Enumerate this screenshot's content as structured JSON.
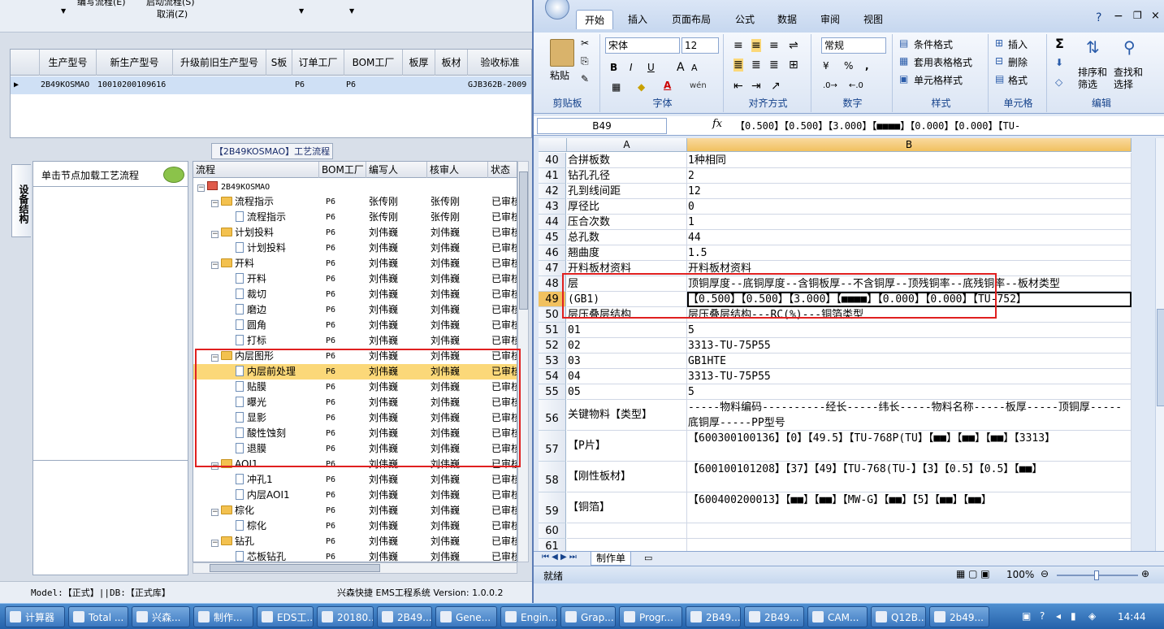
{
  "left_app": {
    "top_menu": {
      "item1": "编写流程(E)",
      "item2": "启动流程(S)",
      "cancel": "取消(Z)"
    },
    "product_grid": {
      "columns": [
        "生产型号",
        "新生产型号",
        "升级前旧生产型号",
        "S板",
        "订单工厂",
        "BOM工厂",
        "板厚",
        "板材",
        "验收标准"
      ],
      "row": {
        "marker": "▶",
        "prod_model": "2B49KOSMAO",
        "new_model": "10010200109616",
        "s_board": "",
        "order_factory": "P6",
        "bom_factory": "P6",
        "standard": "GJB362B-2009"
      }
    },
    "process_title": "【2B49KOSMAO】工艺流程",
    "side_tab": "设备结构",
    "load_hint": "单击节点加载工艺流程",
    "tree_columns": [
      "流程",
      "BOM工厂",
      "编写人",
      "核审人",
      "状态"
    ],
    "tree_root": "2B49KOSMAO",
    "tree_rows": [
      {
        "label": "流程指示",
        "factory": "P6",
        "author": "张传刚",
        "reviewer": "张传刚",
        "status": "已审核"
      },
      {
        "label": "流程指示",
        "factory": "P6",
        "author": "张传刚",
        "reviewer": "张传刚",
        "status": "已审核"
      },
      {
        "label": "计划投料",
        "factory": "P6",
        "author": "刘伟巍",
        "reviewer": "刘伟巍",
        "status": "已审核"
      },
      {
        "label": "计划投料",
        "factory": "P6",
        "author": "刘伟巍",
        "reviewer": "刘伟巍",
        "status": "已审核"
      },
      {
        "label": "开料",
        "factory": "P6",
        "author": "刘伟巍",
        "reviewer": "刘伟巍",
        "status": "已审核"
      },
      {
        "label": "开料",
        "factory": "P6",
        "author": "刘伟巍",
        "reviewer": "刘伟巍",
        "status": "已审核"
      },
      {
        "label": "裁切",
        "factory": "P6",
        "author": "刘伟巍",
        "reviewer": "刘伟巍",
        "status": "已审核"
      },
      {
        "label": "磨边",
        "factory": "P6",
        "author": "刘伟巍",
        "reviewer": "刘伟巍",
        "status": "已审核"
      },
      {
        "label": "圆角",
        "factory": "P6",
        "author": "刘伟巍",
        "reviewer": "刘伟巍",
        "status": "已审核"
      },
      {
        "label": "打标",
        "factory": "P6",
        "author": "刘伟巍",
        "reviewer": "刘伟巍",
        "status": "已审核"
      },
      {
        "label": "内层图形",
        "factory": "P6",
        "author": "刘伟巍",
        "reviewer": "刘伟巍",
        "status": "已审核"
      },
      {
        "label": "内层前处理",
        "factory": "P6",
        "author": "刘伟巍",
        "reviewer": "刘伟巍",
        "status": "已审核"
      },
      {
        "label": "贴膜",
        "factory": "P6",
        "author": "刘伟巍",
        "reviewer": "刘伟巍",
        "status": "已审核"
      },
      {
        "label": "曝光",
        "factory": "P6",
        "author": "刘伟巍",
        "reviewer": "刘伟巍",
        "status": "已审核"
      },
      {
        "label": "显影",
        "factory": "P6",
        "author": "刘伟巍",
        "reviewer": "刘伟巍",
        "status": "已审核"
      },
      {
        "label": "酸性蚀刻",
        "factory": "P6",
        "author": "刘伟巍",
        "reviewer": "刘伟巍",
        "status": "已审核"
      },
      {
        "label": "退膜",
        "factory": "P6",
        "author": "刘伟巍",
        "reviewer": "刘伟巍",
        "status": "已审核"
      },
      {
        "label": "AOI1",
        "factory": "P6",
        "author": "刘伟巍",
        "reviewer": "刘伟巍",
        "status": "已审核"
      },
      {
        "label": "冲孔1",
        "factory": "P6",
        "author": "刘伟巍",
        "reviewer": "刘伟巍",
        "status": "已审核"
      },
      {
        "label": "内层AOI1",
        "factory": "P6",
        "author": "刘伟巍",
        "reviewer": "刘伟巍",
        "status": "已审核"
      },
      {
        "label": "棕化",
        "factory": "P6",
        "author": "刘伟巍",
        "reviewer": "刘伟巍",
        "status": "已审核"
      },
      {
        "label": "棕化",
        "factory": "P6",
        "author": "刘伟巍",
        "reviewer": "刘伟巍",
        "status": "已审核"
      },
      {
        "label": "钻孔",
        "factory": "P6",
        "author": "刘伟巍",
        "reviewer": "刘伟巍",
        "status": "已审核"
      },
      {
        "label": "芯板钻孔",
        "factory": "P6",
        "author": "刘伟巍",
        "reviewer": "刘伟巍",
        "status": "已审核"
      }
    ],
    "status_bar": {
      "model": "Model:【正式】||DB:【正式库】",
      "app": "兴森快捷 EMS工程系统 Version: 1.0.0.2"
    }
  },
  "excel": {
    "ribbon_tabs": [
      "开始",
      "插入",
      "页面布局",
      "公式",
      "数据",
      "审阅",
      "视图"
    ],
    "clipboard": {
      "paste": "粘贴",
      "label": "剪贴板"
    },
    "font": {
      "name": "宋体",
      "size": "12",
      "bold": "B",
      "italic": "I",
      "underline": "U",
      "grow": "A",
      "shrink": "A",
      "label": "字体",
      "color_a": "A",
      "wen": "wén"
    },
    "alignment": {
      "label": "对齐方式"
    },
    "number": {
      "format": "常规",
      "percent": "%",
      "comma": ",",
      "label": "数字"
    },
    "styles": {
      "conditional": "条件格式",
      "table": "套用表格格式",
      "cell": "单元格样式",
      "label": "样式"
    },
    "cells": {
      "insert": "插入",
      "delete": "删除",
      "format": "格式",
      "label": "单元格"
    },
    "editing": {
      "sum": "Σ",
      "sort": "排序和\n筛选",
      "find": "查找和\n选择",
      "label": "编辑"
    },
    "name_box": "B49",
    "fx": "fx",
    "formula": "【0.500】【0.500】【3.000】【■■■■】【0.000】【0.000】【TU-",
    "col_headers": [
      "A",
      "B"
    ],
    "rows": [
      {
        "n": "40",
        "a": "合拼板数",
        "b": "1种相同"
      },
      {
        "n": "41",
        "a": "钻孔孔径",
        "b": "2"
      },
      {
        "n": "42",
        "a": "孔到线间距",
        "b": "12"
      },
      {
        "n": "43",
        "a": "厚径比",
        "b": "0"
      },
      {
        "n": "44",
        "a": "压合次数",
        "b": "1"
      },
      {
        "n": "45",
        "a": "总孔数",
        "b": "44"
      },
      {
        "n": "46",
        "a": "翘曲度",
        "b": "1.5"
      },
      {
        "n": "47",
        "a": "开料板材资料",
        "b": "开料板材资料"
      },
      {
        "n": "48",
        "a": "层",
        "b": "顶铜厚度--底铜厚度--含铜板厚--不含铜厚--顶残铜率--底残铜率--板材类型"
      },
      {
        "n": "49",
        "a": "(GB1)",
        "b": "【0.500】【0.500】【3.000】【■■■■】【0.000】【0.000】【TU-752】"
      },
      {
        "n": "50",
        "a": "层压叠层结构",
        "b": "层压叠层结构---RC(%)---铜箔类型"
      },
      {
        "n": "51",
        "a": "01",
        "b": "5"
      },
      {
        "n": "52",
        "a": "02",
        "b": "3313-TU-75P55"
      },
      {
        "n": "53",
        "a": "03",
        "b": "GB1HTE"
      },
      {
        "n": "54",
        "a": "04",
        "b": "3313-TU-75P55"
      },
      {
        "n": "55",
        "a": "05",
        "b": "5"
      },
      {
        "n": "56",
        "a": "关键物料【类型】",
        "b": "-----物料编码----------经长-----纬长-----物料名称-----板厚-----顶铜厚-----底铜厚-----PP型号"
      },
      {
        "n": "57",
        "a": "【P片】",
        "b": "【600300100136】【0】【49.5】【TU-768P(TU】【■■】【■■】【■■】【3313】"
      },
      {
        "n": "58",
        "a": "【刚性板材】",
        "b": "【600100101208】【37】【49】【TU-768(TU-】【3】【0.5】【0.5】【■■】"
      },
      {
        "n": "59",
        "a": "【铜箔】",
        "b": "【600400200013】【■■】【■■】【MW-G】【■■】【5】【■■】【■■】"
      },
      {
        "n": "60",
        "a": "",
        "b": ""
      },
      {
        "n": "61",
        "a": "",
        "b": ""
      }
    ],
    "sheet_tab": "制作单",
    "status": {
      "ready": "就绪",
      "zoom": "100%"
    }
  },
  "taskbar": {
    "items": [
      "计算器",
      "Total ...",
      "兴森...",
      "制作...",
      "EDS工...",
      "20180...",
      "2B49...",
      "Gene...",
      "Engin...",
      "Grap...",
      "Progr...",
      "2B49...",
      "2B49...",
      "CAM...",
      "Q12B...",
      "2b49..."
    ],
    "clock": "14:44"
  }
}
